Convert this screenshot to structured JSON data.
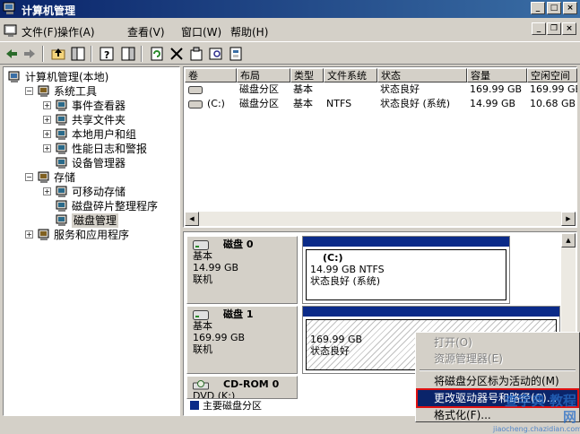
{
  "window": {
    "title": "计算机管理",
    "minimize": "_",
    "maximize": "□",
    "close": "×"
  },
  "menus": [
    {
      "label": "文件(F)",
      "icon": "console-icon"
    },
    {
      "label": "操作(A)"
    },
    {
      "label": "查看(V)"
    },
    {
      "label": "窗口(W)"
    },
    {
      "label": "帮助(H)"
    }
  ],
  "mdi": {
    "minimize": "_",
    "restore": "❐",
    "close": "×"
  },
  "toolbar": [
    "back-icon",
    "forward-icon",
    "up-icon",
    "show-tree-icon",
    "help-icon",
    "show-pane-icon",
    "refresh-icon",
    "delete-icon",
    "properties-icon",
    "search-icon",
    "export-icon"
  ],
  "tree": [
    {
      "label": "计算机管理(本地)",
      "level": 0,
      "toggle": "",
      "icon": "computer-icon"
    },
    {
      "label": "系统工具",
      "level": 1,
      "toggle": "−",
      "icon": "tools-icon"
    },
    {
      "label": "事件查看器",
      "level": 2,
      "toggle": "+",
      "icon": "event-viewer-icon"
    },
    {
      "label": "共享文件夹",
      "level": 2,
      "toggle": "+",
      "icon": "shared-folder-icon"
    },
    {
      "label": "本地用户和组",
      "level": 2,
      "toggle": "+",
      "icon": "users-icon"
    },
    {
      "label": "性能日志和警报",
      "level": 2,
      "toggle": "+",
      "icon": "performance-icon"
    },
    {
      "label": "设备管理器",
      "level": 2,
      "toggle": "",
      "icon": "device-manager-icon"
    },
    {
      "label": "存储",
      "level": 1,
      "toggle": "−",
      "icon": "storage-icon"
    },
    {
      "label": "可移动存储",
      "level": 2,
      "toggle": "+",
      "icon": "removable-storage-icon"
    },
    {
      "label": "磁盘碎片整理程序",
      "level": 2,
      "toggle": "",
      "icon": "defrag-icon"
    },
    {
      "label": "磁盘管理",
      "level": 2,
      "toggle": "",
      "icon": "disk-management-icon",
      "selected": true
    },
    {
      "label": "服务和应用程序",
      "level": 1,
      "toggle": "+",
      "icon": "services-icon"
    }
  ],
  "volume_table": {
    "columns": [
      "卷",
      "布局",
      "类型",
      "文件系统",
      "状态",
      "容量",
      "空闲空间"
    ],
    "rows": [
      [
        "",
        "磁盘分区",
        "基本",
        "",
        "状态良好",
        "169.99 GB",
        "169.99 GB"
      ],
      [
        "(C:)",
        "磁盘分区",
        "基本",
        "NTFS",
        "状态良好 (系统)",
        "14.99 GB",
        "10.68 GB"
      ]
    ]
  },
  "disks": [
    {
      "name": "磁盘 0",
      "type": "基本",
      "size": "14.99 GB",
      "status": "联机",
      "partition": {
        "label": "(C:)",
        "size_fs": "14.99 GB NTFS",
        "status": "状态良好 (系统)"
      }
    },
    {
      "name": "磁盘 1",
      "type": "基本",
      "size": "169.99 GB",
      "status": "联机",
      "partition": {
        "label": "",
        "size_fs": "169.99 GB",
        "status": "状态良好"
      }
    },
    {
      "name": "CD-ROM 0",
      "type": "DVD (K:)"
    }
  ],
  "legend": {
    "primary": "主要磁盘分区"
  },
  "context_menu": [
    {
      "label": "打开(O)",
      "disabled": true
    },
    {
      "label": "资源管理器(E)",
      "disabled": true
    },
    {
      "label": "将磁盘分区标为活动的(M)"
    },
    {
      "label": "更改驱动器号和路径(C)...",
      "highlighted": true
    },
    {
      "label": "格式化(F)..."
    }
  ],
  "watermark": {
    "main": "查字典 教程网",
    "sub": "jiaocheng.chazidian.com"
  },
  "colors": {
    "title_bar": "#0a246a",
    "partition_bar": "#0a2a88",
    "highlight_outline": "#e01010"
  }
}
